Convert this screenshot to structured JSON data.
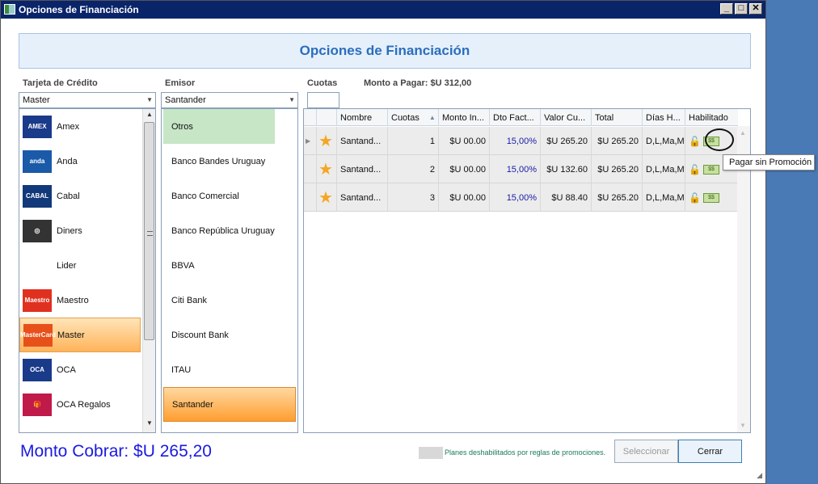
{
  "window": {
    "title": "Opciones de Financiación"
  },
  "header": {
    "title": "Opciones de Financiación"
  },
  "labels": {
    "tarjeta": "Tarjeta de Crédito",
    "emisor": "Emisor",
    "cuotas": "Cuotas",
    "monto_pagar": "Monto a Pagar: $U 312,00"
  },
  "combos": {
    "tarjeta": "Master",
    "emisor": "Santander",
    "cuotas": ""
  },
  "cards": [
    {
      "label": "Amex",
      "icon": "amex-logo-icon",
      "logo_text": "AMEX",
      "logo_color": "#1a3a8a"
    },
    {
      "label": "Anda",
      "icon": "anda-logo-icon",
      "logo_text": "anda",
      "logo_color": "#1a5aa8"
    },
    {
      "label": "Cabal",
      "icon": "cabal-logo-icon",
      "logo_text": "CABAL",
      "logo_color": "#123a7a"
    },
    {
      "label": "Diners",
      "icon": "diners-logo-icon",
      "logo_text": "◎",
      "logo_color": "#333333"
    },
    {
      "label": "Lider",
      "icon": "",
      "logo_text": "",
      "logo_color": ""
    },
    {
      "label": "Maestro",
      "icon": "maestro-logo-icon",
      "logo_text": "Maestro",
      "logo_color": "#e03020"
    },
    {
      "label": "Master",
      "icon": "mastercard-logo-icon",
      "logo_text": "MasterCard",
      "logo_color": "#e8501a",
      "selected": true
    },
    {
      "label": "OCA",
      "icon": "oca-logo-icon",
      "logo_text": "OCA",
      "logo_color": "#1a3a8a"
    },
    {
      "label": "OCA Regalos",
      "icon": "oca-regalos-logo-icon",
      "logo_text": "🎁",
      "logo_color": "#c01a4a"
    }
  ],
  "emisores": [
    "Otros",
    "Banco Bandes Uruguay",
    "Banco Comercial",
    "Banco República Uruguay",
    "BBVA",
    "Citi Bank",
    "Discount Bank",
    "ITAU",
    "Santander"
  ],
  "grid": {
    "columns": [
      "Nombre",
      "Cuotas",
      "Monto In...",
      "Dto Fact...",
      "Valor Cu...",
      "Total",
      "Días H...",
      "Habilitado"
    ],
    "rows": [
      {
        "nombre": "Santand...",
        "cuotas": "1",
        "monto": "$U 00.00",
        "dto": "15,00%",
        "valor": "$U 265.20",
        "total": "$U 265.20",
        "dias": "D,L,Ma,M"
      },
      {
        "nombre": "Santand...",
        "cuotas": "2",
        "monto": "$U 00.00",
        "dto": "15,00%",
        "valor": "$U 132.60",
        "total": "$U 265.20",
        "dias": "D,L,Ma,M"
      },
      {
        "nombre": "Santand...",
        "cuotas": "3",
        "monto": "$U 00.00",
        "dto": "15,00%",
        "valor": "$U 88.40",
        "total": "$U 265.20",
        "dias": "D,L,Ma,M"
      }
    ]
  },
  "tooltip": "Pagar sin Promoción",
  "monto_cobrar": "Monto Cobrar: $U 265,20",
  "legend": "Planes deshabilitados por reglas de promociones.",
  "buttons": {
    "seleccionar": "Seleccionar",
    "cerrar": "Cerrar"
  }
}
